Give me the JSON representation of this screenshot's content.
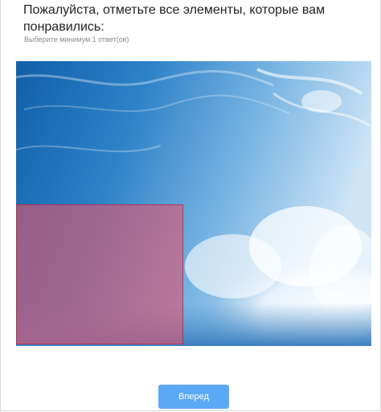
{
  "question": {
    "title": "Пожалуйста, отметьте все элементы, которые вам понравились:",
    "hint": "Выберите минимум 1 ответ(ов)"
  },
  "image": {
    "selected_regions": 1,
    "selection_color": "#e2546e"
  },
  "navigation": {
    "next_label": "Вперед",
    "next_color": "#5aa9f5"
  }
}
